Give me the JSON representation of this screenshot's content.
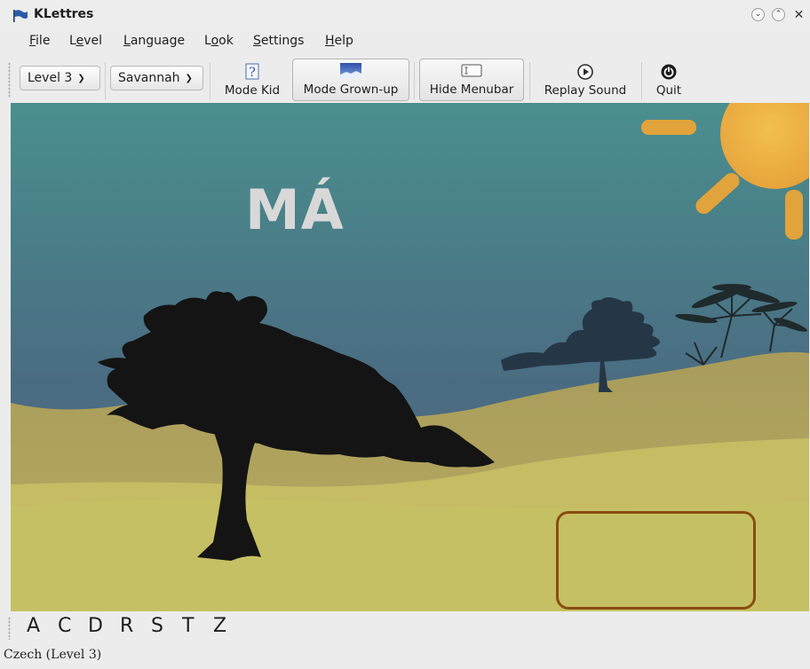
{
  "window": {
    "title": "KLettres",
    "controls": [
      "minimize",
      "maximize",
      "close"
    ]
  },
  "menubar": {
    "items": [
      {
        "label": "File",
        "mnemonic": "F",
        "rest": "ile"
      },
      {
        "label": "Level",
        "pre": "L",
        "mnemonic": "e",
        "rest": "vel"
      },
      {
        "label": "Language",
        "mnemonic": "L",
        "rest": "anguage"
      },
      {
        "label": "Look",
        "pre": "L",
        "mnemonic": "o",
        "rest": "ok"
      },
      {
        "label": "Settings",
        "mnemonic": "S",
        "rest": "ettings"
      },
      {
        "label": "Help",
        "mnemonic": "H",
        "rest": "elp"
      }
    ]
  },
  "toolbar": {
    "level_combo": "Level 3",
    "theme_combo": "Savannah",
    "mode_kid": "Mode Kid",
    "mode_grownup": "Mode Grown-up",
    "hide_menubar": "Hide Menubar",
    "replay_sound": "Replay Sound",
    "quit": "Quit"
  },
  "game": {
    "word": "MÁ",
    "theme": "savannah",
    "colors": {
      "sky_top": "#4a8f8e",
      "sky_bottom": "#4b6d83",
      "ground": "#c8bf63",
      "hill": "#b1a55f",
      "silhouette": "#141414",
      "sun": "#e7a93a",
      "answer_border": "#8a4d12"
    }
  },
  "letters": [
    "A",
    "C",
    "D",
    "R",
    "S",
    "T",
    "Z"
  ],
  "status": "Czech (Level 3)"
}
